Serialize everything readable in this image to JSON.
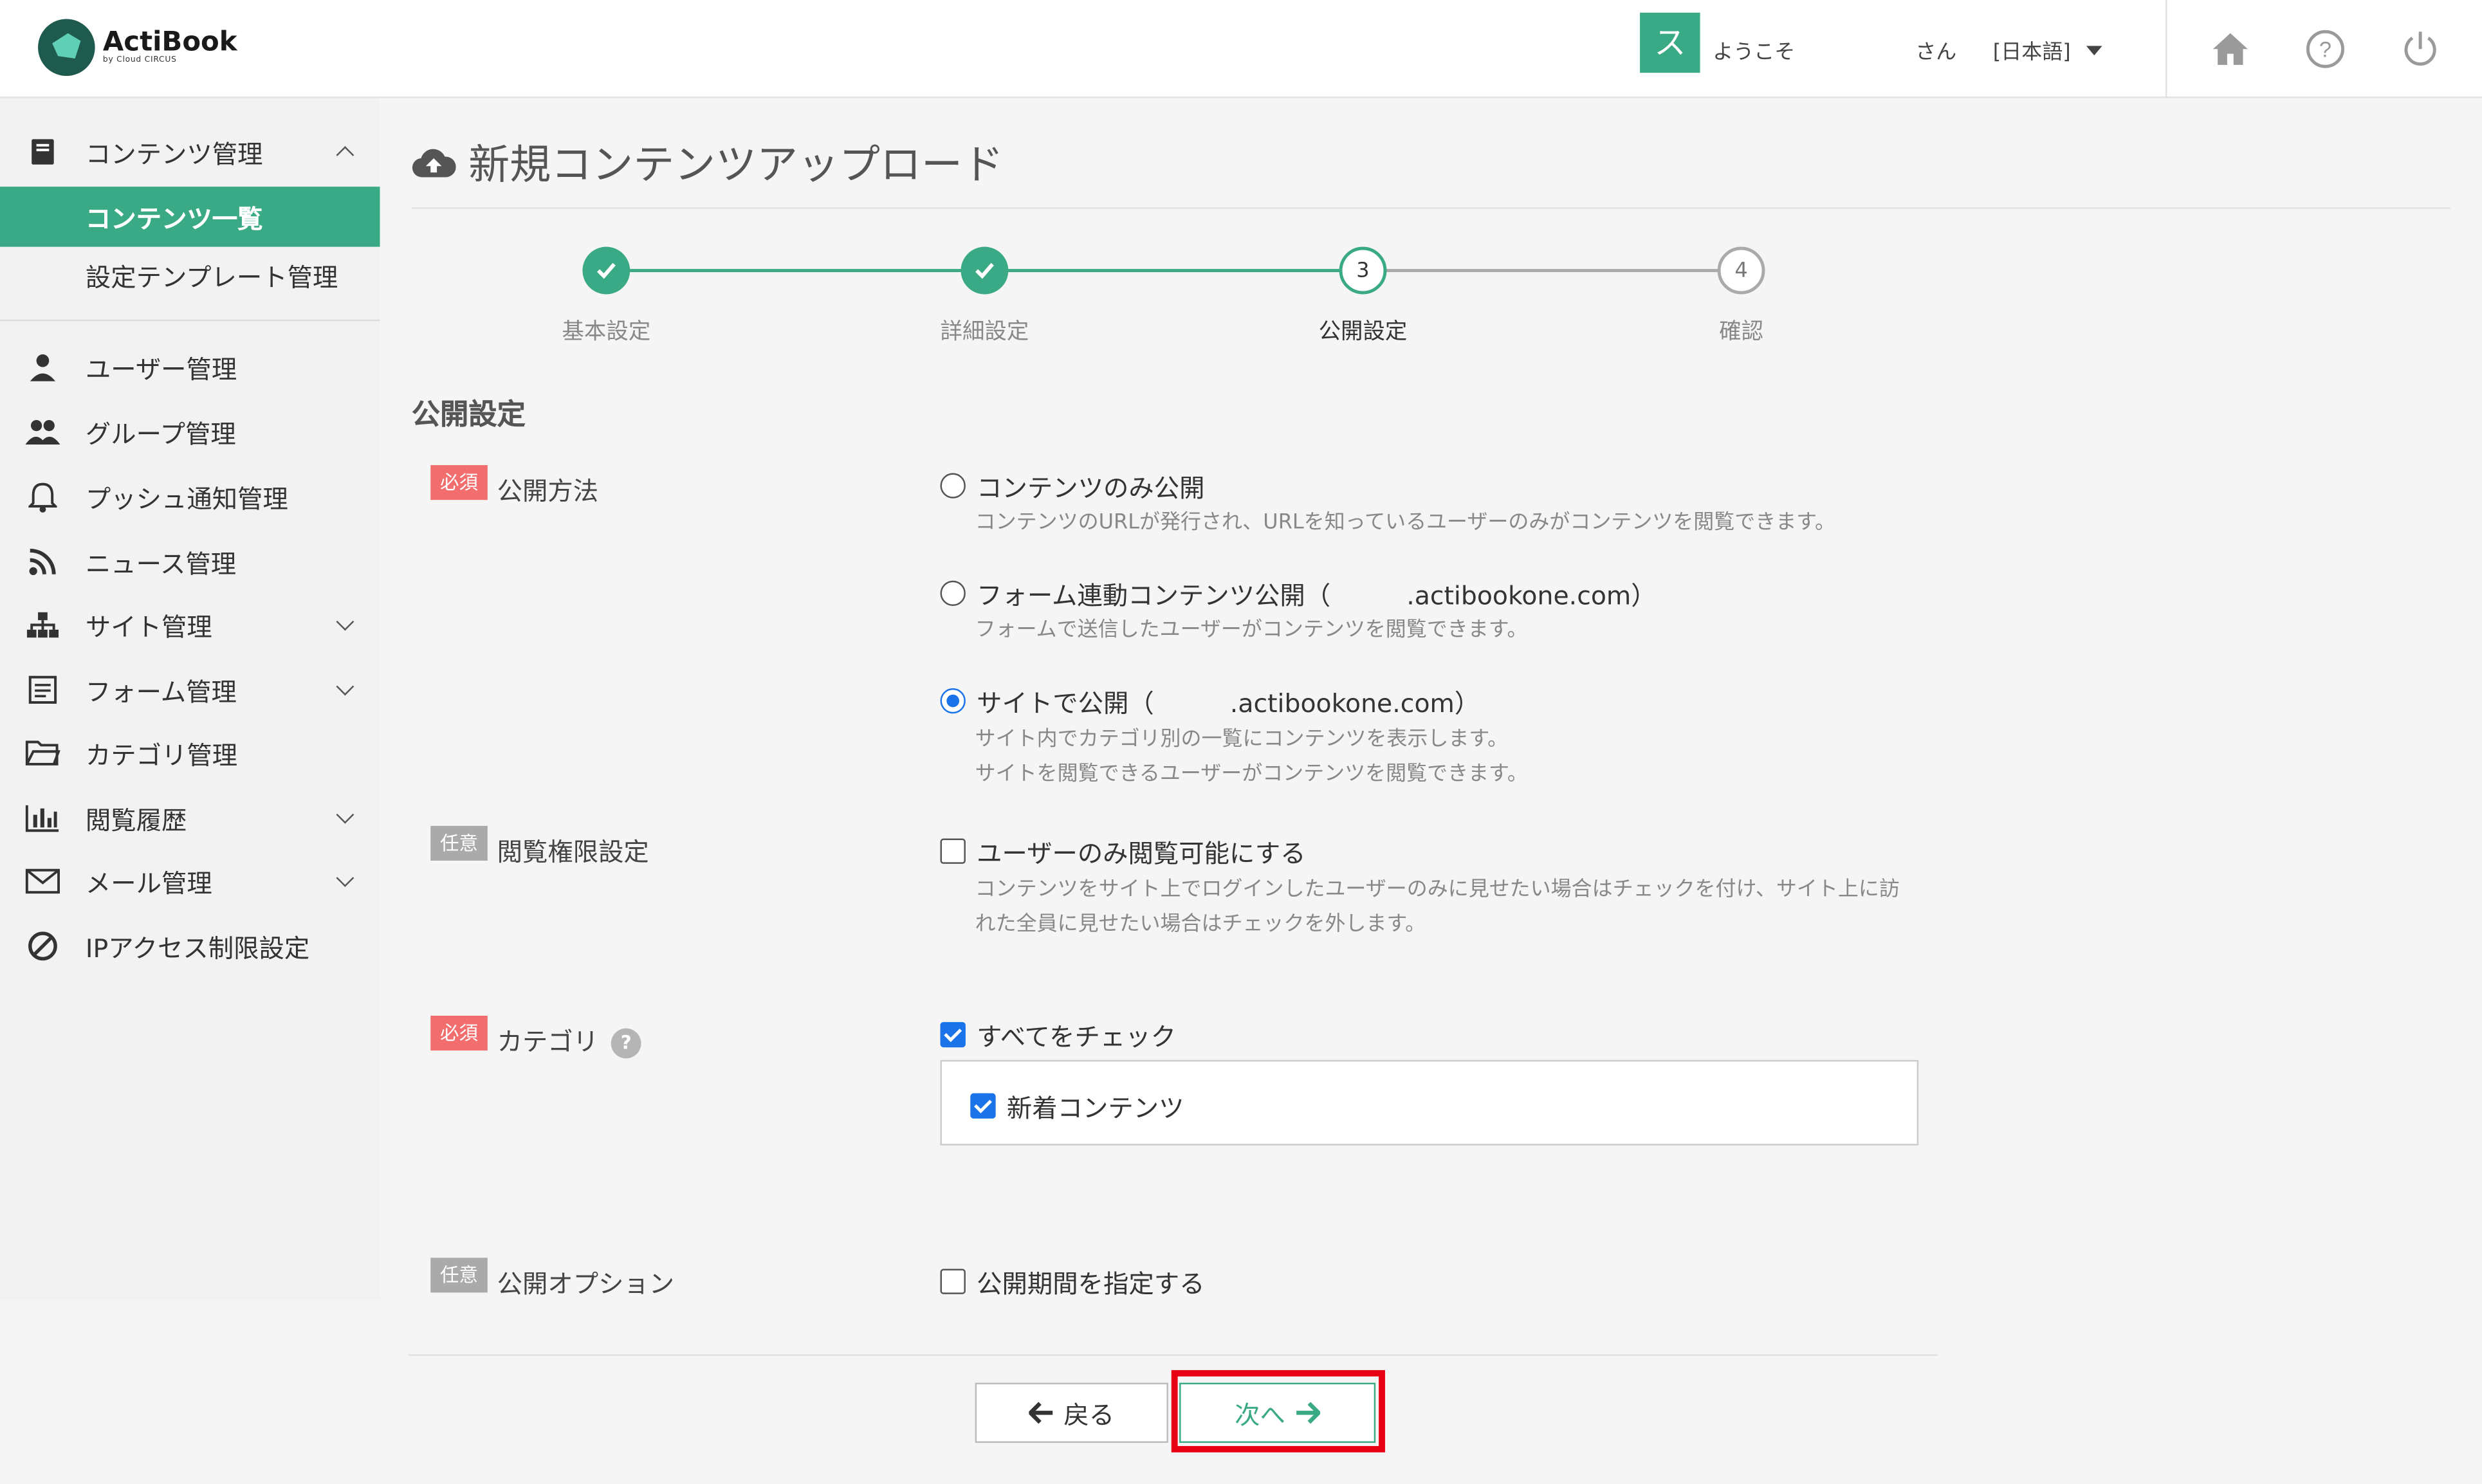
{
  "header": {
    "app_name": "ActiBook",
    "app_sub": "by Cloud CIRCUS",
    "avatar_initial": "ス",
    "welcome": "ようこそ",
    "san": "さん",
    "language": "[日本語]",
    "accent_color": "#3aa985"
  },
  "sidebar": {
    "items": [
      {
        "label": "コンテンツ管理",
        "icon": "book-icon",
        "expand": "up"
      },
      {
        "label": "コンテンツ一覧",
        "sub": true,
        "active": true
      },
      {
        "label": "設定テンプレート管理",
        "sub": true
      },
      {
        "label": "ユーザー管理",
        "icon": "user-icon"
      },
      {
        "label": "グループ管理",
        "icon": "users-icon"
      },
      {
        "label": "プッシュ通知管理",
        "icon": "bell-icon"
      },
      {
        "label": "ニュース管理",
        "icon": "rss-icon"
      },
      {
        "label": "サイト管理",
        "icon": "sitemap-icon",
        "expand": "down"
      },
      {
        "label": "フォーム管理",
        "icon": "form-icon",
        "expand": "down"
      },
      {
        "label": "カテゴリ管理",
        "icon": "folder-icon"
      },
      {
        "label": "閲覧履歴",
        "icon": "chart-icon",
        "expand": "down"
      },
      {
        "label": "メール管理",
        "icon": "mail-icon",
        "expand": "down"
      },
      {
        "label": "IPアクセス制限設定",
        "icon": "ban-icon"
      }
    ]
  },
  "page": {
    "title": "新規コンテンツアップロード",
    "steps": [
      {
        "label": "基本設定",
        "num": "1",
        "state": "done"
      },
      {
        "label": "詳細設定",
        "num": "2",
        "state": "done"
      },
      {
        "label": "公開設定",
        "num": "3",
        "state": "current"
      },
      {
        "label": "確認",
        "num": "4",
        "state": "todo"
      }
    ],
    "section_title": "公開設定",
    "badges": {
      "required": "必須",
      "optional": "任意"
    },
    "fields": {
      "publish_method": {
        "label": "公開方法",
        "options": [
          {
            "label": "コンテンツのみ公開",
            "desc": "コンテンツのURLが発行され、URLを知っているユーザーのみがコンテンツを閲覧できます。",
            "selected": false
          },
          {
            "label": "フォーム連動コンテンツ公開（　　　.actibookone.com）",
            "desc": "フォームで送信したユーザーがコンテンツを閲覧できます。",
            "selected": false
          },
          {
            "label": "サイトで公開（　　　.actibookone.com）",
            "desc": "サイト内でカテゴリ別の一覧にコンテンツを表示します。",
            "desc2": "サイトを閲覧できるユーザーがコンテンツを閲覧できます。",
            "selected": true
          }
        ]
      },
      "view_permission": {
        "label": "閲覧権限設定",
        "checkbox": "ユーザーのみ閲覧可能にする",
        "checked": false,
        "desc": "コンテンツをサイト上でログインしたユーザーのみに見せたい場合はチェックを付け、サイト上に訪",
        "desc2": "れた全員に見せたい場合はチェックを外します。"
      },
      "category": {
        "label": "カテゴリ",
        "help": "?",
        "check_all": "すべてをチェック",
        "check_all_checked": true,
        "items": [
          {
            "label": "新着コンテンツ",
            "checked": true
          }
        ]
      },
      "publish_option": {
        "label": "公開オプション",
        "checkbox": "公開期間を指定する",
        "checked": false
      }
    },
    "buttons": {
      "back": "戻る",
      "next": "次へ"
    }
  }
}
